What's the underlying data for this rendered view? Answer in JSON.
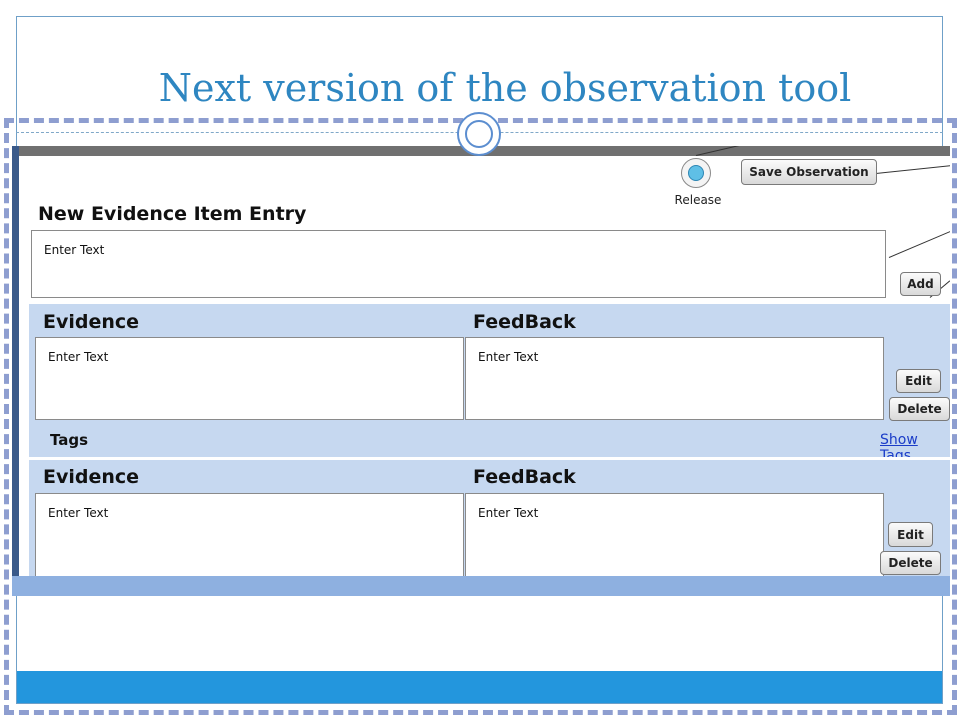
{
  "slide": {
    "title": "Next version of the observation tool",
    "colors": {
      "title": "#2e86c1",
      "dash_frame": "#8e9ed0",
      "footer": "#2396dd"
    }
  },
  "app": {
    "release": {
      "label": "Release",
      "icon": "radio-dot-icon"
    },
    "save_button": "Save Observation",
    "new_entry": {
      "heading": "New Evidence Item Entry",
      "placeholder": "Enter Text",
      "add_button": "Add"
    },
    "items": [
      {
        "evidence_label": "Evidence",
        "feedback_label": "FeedBack",
        "evidence_placeholder": "Enter Text",
        "feedback_placeholder": "Enter Text",
        "edit_button": "Edit",
        "delete_button": "Delete",
        "tags_label": "Tags",
        "show_tags_link": "Show Tags"
      },
      {
        "evidence_label": "Evidence",
        "feedback_label": "FeedBack",
        "evidence_placeholder": "Enter Text",
        "feedback_placeholder": "Enter Text",
        "edit_button": "Edit",
        "delete_button": "Delete"
      }
    ],
    "colors": {
      "section_bg": "#c6d8f0",
      "link": "#1a3cc8",
      "release_dot": "#5fbfe6"
    }
  }
}
